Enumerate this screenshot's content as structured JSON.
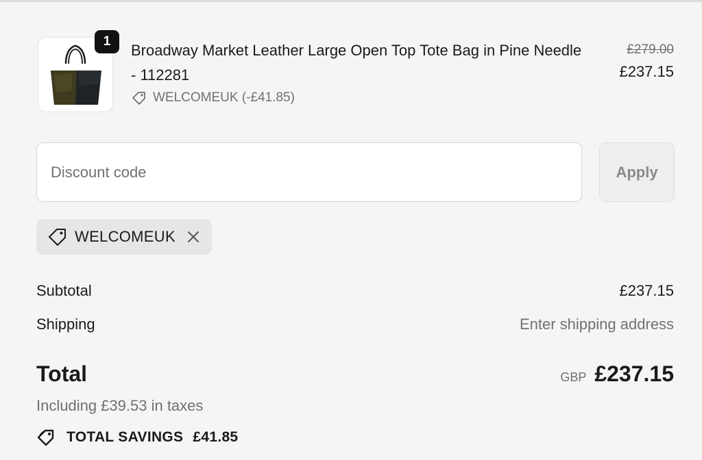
{
  "product": {
    "quantity": "1",
    "title": "Broadway Market Leather Large Open Top Tote Bag in Pine Needle - 112281",
    "discount_text": "WELCOMEUK (-£41.85)",
    "original_price": "£279.00",
    "price": "£237.15",
    "image_icon": "tote-bag-image"
  },
  "discount": {
    "placeholder": "Discount code",
    "value": "",
    "apply_label": "Apply",
    "applied_code": "WELCOMEUK"
  },
  "summary": {
    "subtotal_label": "Subtotal",
    "subtotal_value": "£237.15",
    "shipping_label": "Shipping",
    "shipping_value": "Enter shipping address",
    "total_label": "Total",
    "currency": "GBP",
    "total_value": "£237.15",
    "taxes_text": "Including £39.53 in taxes",
    "savings_label": "TOTAL SAVINGS",
    "savings_value": "£41.85"
  },
  "colors": {
    "background": "#f5f5f5",
    "text": "#1a1a1a",
    "muted": "#707070",
    "badge": "#111111"
  }
}
